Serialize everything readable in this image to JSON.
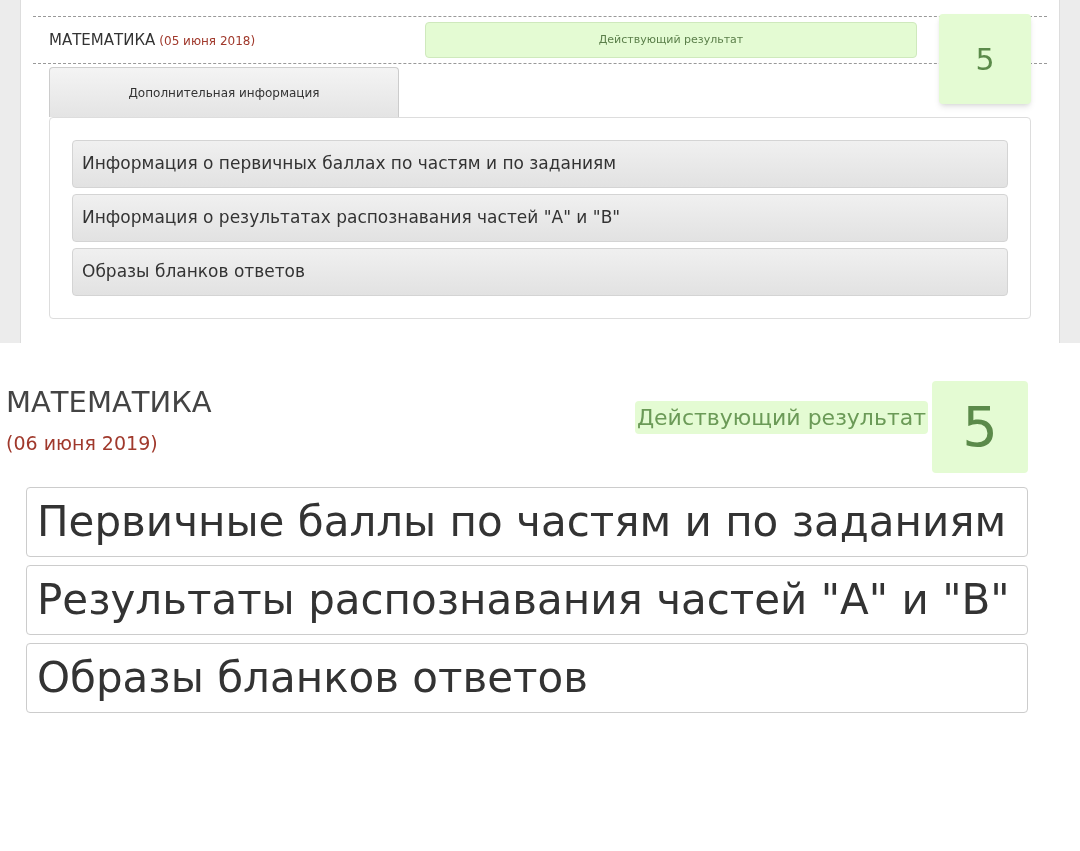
{
  "top_result": {
    "subject": "МАТЕМАТИКА",
    "date": "(05 июня 2018)",
    "result_label": "Действующий результат",
    "grade": "5",
    "tabs": [
      {
        "label": "Дополнительная информация",
        "selected": true
      }
    ],
    "links": [
      "Информация о первичных баллах по частям и по заданиям",
      "Информация о результатах распознавания частей \"А\" и \"В\"",
      "Образы бланков ответов"
    ]
  },
  "bottom_result": {
    "subject": "МАТЕМАТИКА",
    "date": "(06 июня 2019)",
    "result_label": "Действующий результат",
    "grade": "5",
    "links": [
      "Первичные баллы по частям и по заданиям",
      "Результаты распознавания частей \"А\" и \"В\"",
      "Образы бланков ответов"
    ]
  }
}
